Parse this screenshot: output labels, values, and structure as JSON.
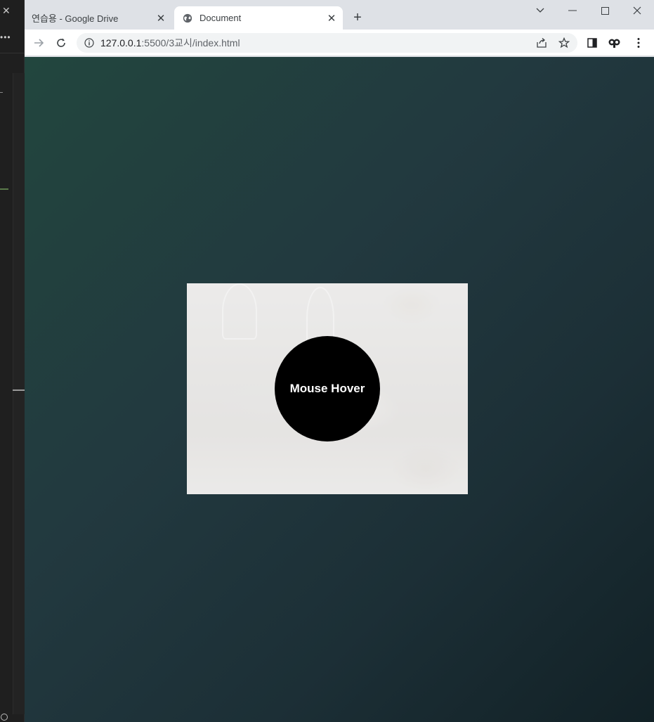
{
  "browser": {
    "tabs": [
      {
        "title": "연습용 - Google Drive",
        "active": false
      },
      {
        "title": "Document",
        "active": true
      }
    ],
    "address": {
      "host": "127.0.0.1",
      "path": ":5500/3교시/index.html"
    }
  },
  "page": {
    "hover_label": "Mouse Hover"
  },
  "icons": {
    "back": "back-arrow-icon",
    "forward": "forward-arrow-icon",
    "reload": "reload-icon",
    "info": "info-icon",
    "share": "share-icon",
    "bookmark": "star-icon",
    "side_panel": "side-panel-icon",
    "profile": "profile-icon",
    "menu": "kebab-menu-icon"
  },
  "colors": {
    "bg_gradient_start": "#22463e",
    "bg_gradient_end": "#122126",
    "circle": "#000000",
    "circle_text": "#ffffff"
  }
}
